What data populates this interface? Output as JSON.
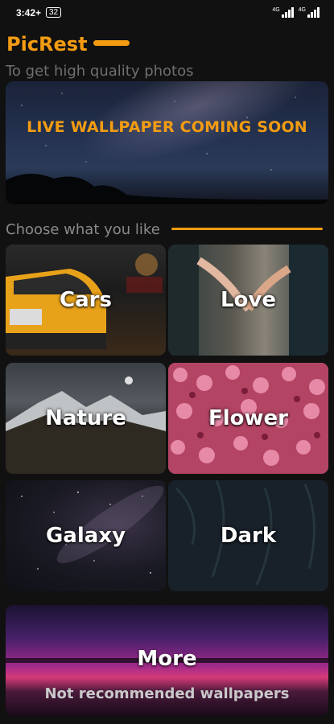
{
  "status_bar": {
    "time": "3:42",
    "plus": "+",
    "battery": "32",
    "signal_1": "4G",
    "signal_2": "4G"
  },
  "header": {
    "title": "PicRest",
    "subtitle": "To get high quality photos"
  },
  "banner": {
    "text": "LIVE WALLPAPER COMING SOON"
  },
  "section": {
    "title": "Choose what you like"
  },
  "categories": [
    {
      "label": "Cars"
    },
    {
      "label": "Love"
    },
    {
      "label": "Nature"
    },
    {
      "label": "Flower"
    },
    {
      "label": "Galaxy"
    },
    {
      "label": "Dark"
    }
  ],
  "more": {
    "label": "More",
    "subtitle": "Not recommended wallpapers"
  },
  "colors": {
    "accent": "#f39c12",
    "background": "#111111"
  }
}
